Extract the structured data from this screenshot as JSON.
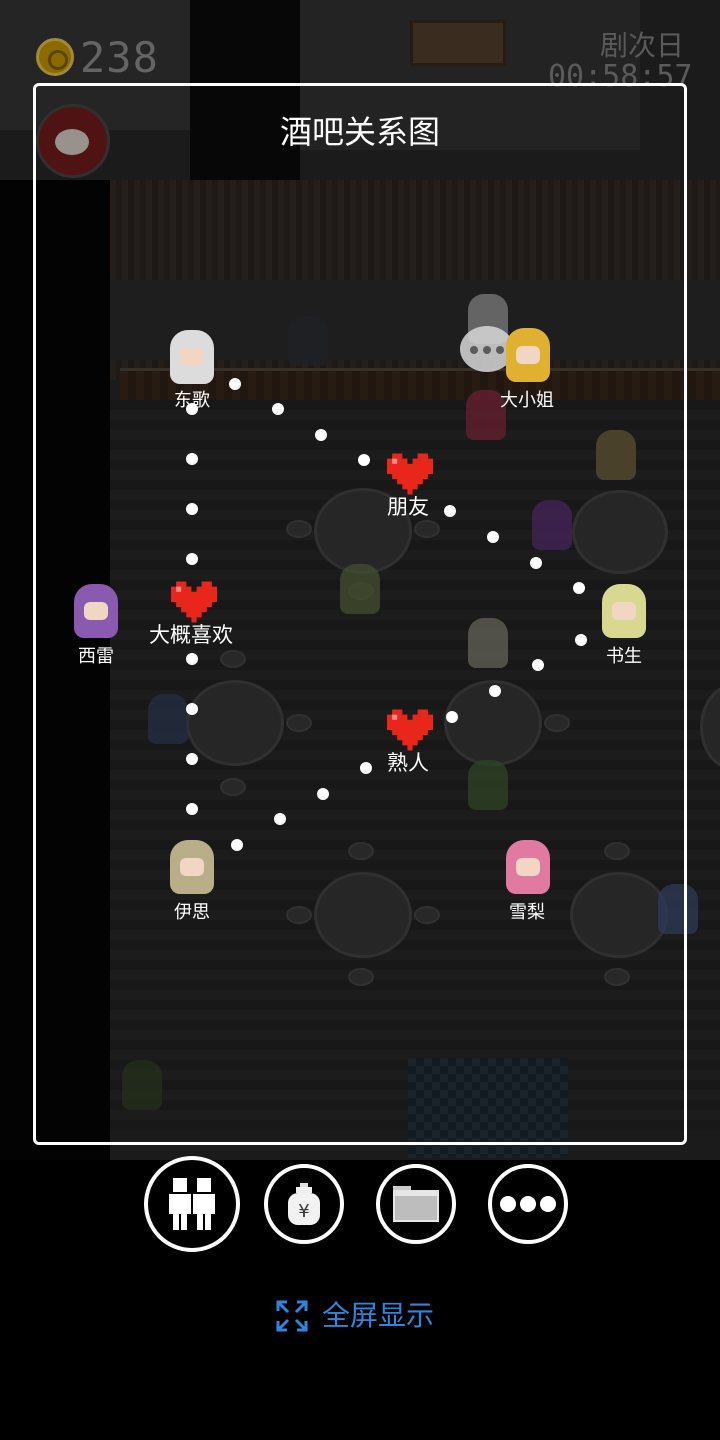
{
  "hud": {
    "coins": "238",
    "coin_icon": "coin-icon",
    "day": "剧次日",
    "time": "00:58:57",
    "social_icon": "weibo-icon"
  },
  "panel": {
    "title": "酒吧关系图"
  },
  "characters": [
    {
      "id": "dongge",
      "name": "东歌",
      "color": "#dcdcdc"
    },
    {
      "id": "daxiaojie",
      "name": "大小姐",
      "color": "#e0b030"
    },
    {
      "id": "xilei",
      "name": "西雷",
      "color": "#8a5ab0"
    },
    {
      "id": "shusheng",
      "name": "书生",
      "color": "#d8d890"
    },
    {
      "id": "yisi",
      "name": "伊思",
      "color": "#b8ae88"
    },
    {
      "id": "xueli",
      "name": "雪梨",
      "color": "#e07aa0"
    }
  ],
  "relations": [
    {
      "label": "朋友",
      "icon": "heart-icon"
    },
    {
      "label": "大概喜欢",
      "icon": "heart-icon"
    },
    {
      "label": "熟人",
      "icon": "heart-icon"
    }
  ],
  "colors": {
    "accent_blue": "#2f86e0",
    "heart_red": "#e8261c",
    "frame_white": "#ffffff"
  },
  "toolbar": {
    "buttons": [
      {
        "icon": "people-icon"
      },
      {
        "icon": "money-bag-icon"
      },
      {
        "icon": "folder-icon"
      },
      {
        "icon": "more-icon"
      }
    ],
    "fullscreen_label": "全屏显示",
    "fullscreen_icon": "expand-icon"
  }
}
